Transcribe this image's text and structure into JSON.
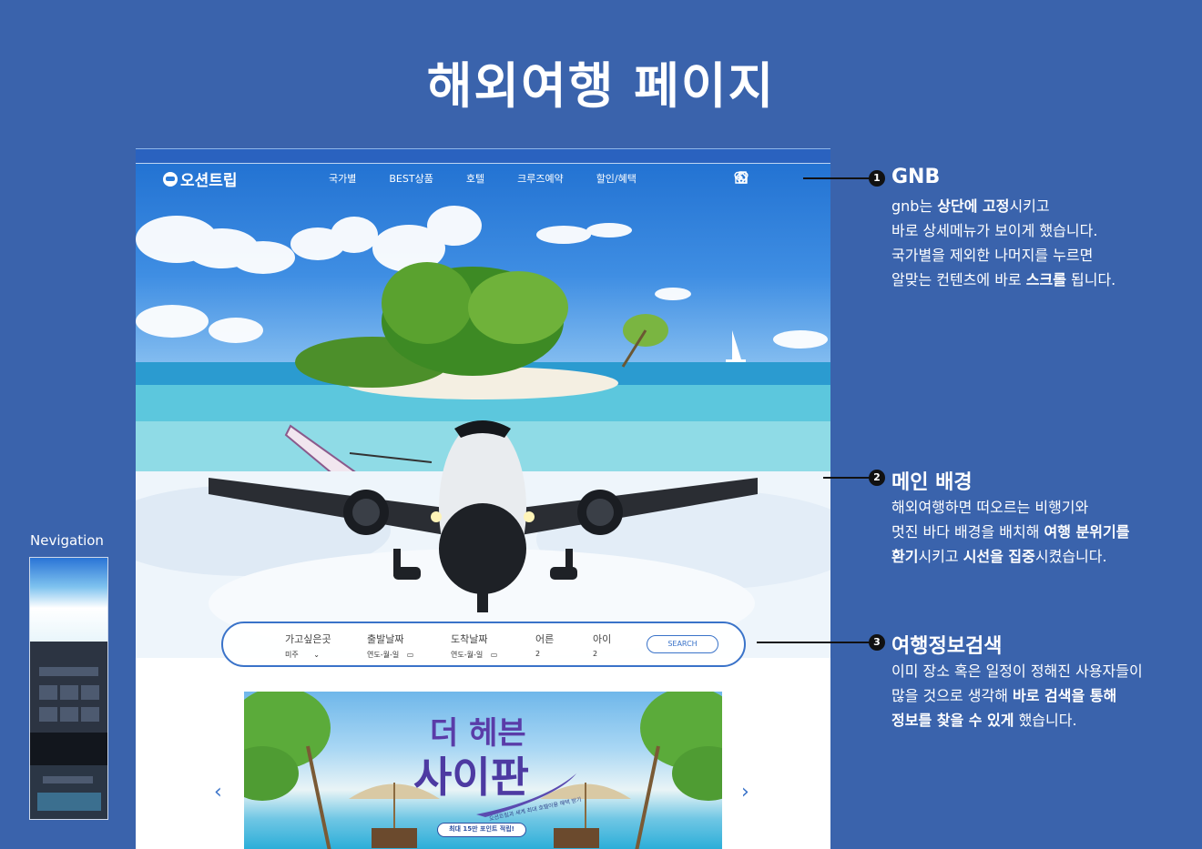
{
  "page_title": "해외여행 페이지",
  "colors": {
    "background": "#3a63ac",
    "accent": "#3a73c9",
    "banner_text": "#4d3aa2"
  },
  "gnb": {
    "logo": "오션트립",
    "menu": [
      "국가별",
      "BEST상품",
      "호텔",
      "크루즈예약",
      "할인/혜택"
    ],
    "icons": [
      "heart-icon",
      "login-icon",
      "home-icon"
    ]
  },
  "search": {
    "fields": [
      {
        "label": "가고싶은곳",
        "value": "미주"
      },
      {
        "label": "출발날짜",
        "value": "연도-월-일"
      },
      {
        "label": "도착날짜",
        "value": "연도-월-일"
      },
      {
        "label": "어른",
        "value": "2"
      },
      {
        "label": "아이",
        "value": "2"
      }
    ],
    "button": "SEARCH"
  },
  "banner": {
    "title_line1": "더 헤븐",
    "title_line2": "사이판",
    "subtitle": "오션트립과 세계 최대 호텔이용 혜택 받기",
    "points_pill": "최대 15만 포인트 적립!",
    "prev": "‹",
    "next": "›"
  },
  "annotations": [
    {
      "num": "1",
      "title": "GNB",
      "lines": [
        [
          [
            "gnb는 ",
            false
          ],
          [
            "상단에 고정",
            true
          ],
          [
            "시키고",
            false
          ]
        ],
        [
          [
            "바로 상세메뉴가 보이게 했습니다.",
            false
          ]
        ],
        [
          [
            "국가별을 제외한 나머지를 누르면",
            false
          ]
        ],
        [
          [
            "알맞는 컨텐츠에 바로 ",
            false
          ],
          [
            "스크롤",
            true
          ],
          [
            " 됩니다.",
            false
          ]
        ]
      ]
    },
    {
      "num": "2",
      "title": "메인 배경",
      "lines": [
        [
          [
            "해외여행하면 떠오르는 비행기와",
            false
          ]
        ],
        [
          [
            "멋진 바다 배경을 배치해 ",
            false
          ],
          [
            "여행 분위기를",
            true
          ]
        ],
        [
          [
            "환기",
            true
          ],
          [
            "시키고 ",
            false
          ],
          [
            "시선을 집중",
            true
          ],
          [
            "시켰습니다.",
            false
          ]
        ]
      ]
    },
    {
      "num": "3",
      "title": "여행정보검색",
      "lines": [
        [
          [
            "이미 장소 혹은 일정이 정해진 사용자들이",
            false
          ]
        ],
        [
          [
            "많을 것으로 생각해 ",
            false
          ],
          [
            "바로 검색을 통해",
            true
          ]
        ],
        [
          [
            "정보를 찾을 수 있게",
            true
          ],
          [
            " 했습니다.",
            false
          ]
        ]
      ]
    }
  ],
  "nav": {
    "label": "Nevigation"
  }
}
